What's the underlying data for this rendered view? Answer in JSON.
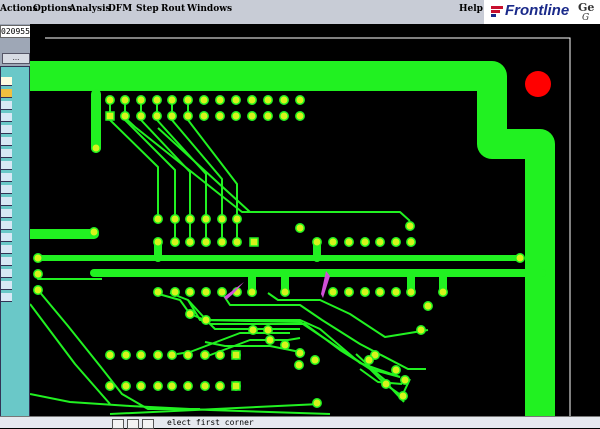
{
  "menubar": {
    "items": [
      "Actions",
      "Options",
      "Analysis",
      "DFM",
      "Step",
      "Rout",
      "Windows"
    ],
    "help": "Help"
  },
  "brand": {
    "name": "Frontline",
    "tail1": "Ge",
    "tail2": "G"
  },
  "left_panel": {
    "job_field": "020955",
    "more_label": "..."
  },
  "status": {
    "prompt": "elect first corner"
  },
  "colors": {
    "copper": "#21f121",
    "pad": "#d6f41c",
    "marker": "#ff0000",
    "highlight": "#d14fd8",
    "background": "#000000"
  }
}
